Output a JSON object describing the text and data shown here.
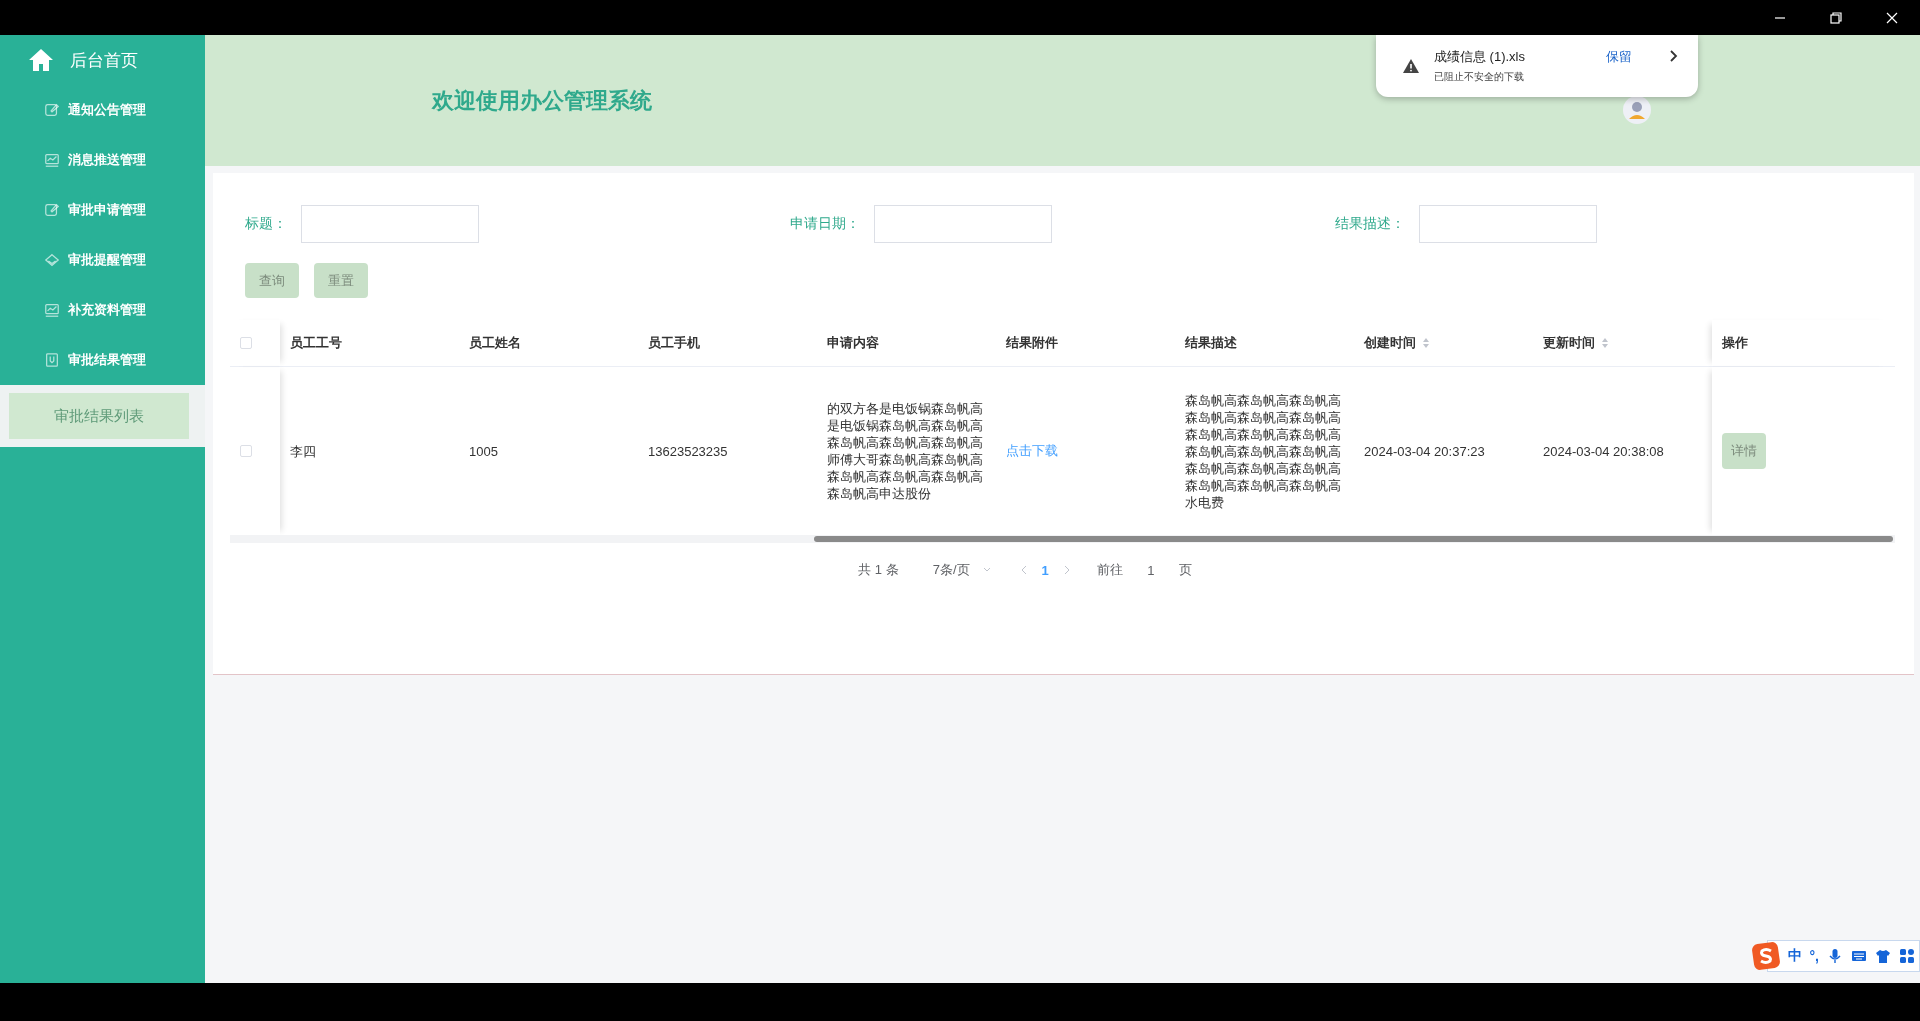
{
  "sidebar": {
    "home": "后台首页",
    "items": [
      {
        "label": "通知公告管理"
      },
      {
        "label": "消息推送管理"
      },
      {
        "label": "审批申请管理"
      },
      {
        "label": "审批提醒管理"
      },
      {
        "label": "补充资料管理"
      },
      {
        "label": "审批结果管理",
        "children": [
          {
            "label": "审批结果列表",
            "selected": true
          }
        ]
      }
    ]
  },
  "header": {
    "title": "欢迎使用办公管理系统"
  },
  "download_popup": {
    "file": "成绩信息 (1).xls",
    "message": "已阻止不安全的下载",
    "action": "保留"
  },
  "filters": [
    {
      "label": "标题："
    },
    {
      "label": "申请日期："
    },
    {
      "label": "结果描述："
    }
  ],
  "buttons": [
    "查询",
    "重置"
  ],
  "table": {
    "header_checked": false,
    "columns": [
      {
        "label": "员工工号",
        "sortable": false
      },
      {
        "label": "员工姓名",
        "sortable": false
      },
      {
        "label": "员工手机",
        "sortable": false
      },
      {
        "label": "申请内容",
        "sortable": false
      },
      {
        "label": "结果附件",
        "sortable": false
      },
      {
        "label": "结果描述",
        "sortable": false
      },
      {
        "label": "创建时间",
        "sortable": true
      },
      {
        "label": "更新时间",
        "sortable": true
      },
      {
        "label": "操作",
        "sortable": false
      }
    ],
    "rows": [
      {
        "checked": false,
        "cells": [
          {
            "kind": "text",
            "text": "李四"
          },
          {
            "kind": "text",
            "text": "1005"
          },
          {
            "kind": "text",
            "text": "13623523235"
          },
          {
            "kind": "text",
            "text": "的双方各是电饭锅森岛帆高是电饭锅森岛帆高森岛帆高森岛帆高森岛帆高森岛帆高师傅大哥森岛帆高森岛帆高森岛帆高森岛帆高森岛帆高森岛帆高申达股份"
          },
          {
            "kind": "link",
            "text": "点击下载"
          },
          {
            "kind": "text",
            "text": "森岛帆高森岛帆高森岛帆高森岛帆高森岛帆高森岛帆高森岛帆高森岛帆高森岛帆高森岛帆高森岛帆高森岛帆高森岛帆高森岛帆高森岛帆高森岛帆高森岛帆高森岛帆高水电费"
          },
          {
            "kind": "text",
            "text": "2024-03-04 20:37:23"
          },
          {
            "kind": "text",
            "text": "2024-03-04 20:38:08"
          }
        ],
        "action": "详情"
      }
    ]
  },
  "pagination": {
    "total": "共 1 条",
    "page_size": "7条/页",
    "pages": [
      {
        "label": "1",
        "selected": true
      }
    ],
    "goto": "前往",
    "goto_value": "1",
    "page_unit": "页"
  },
  "ime_toolbar": {
    "mode": "中",
    "punctuation": "°,"
  }
}
